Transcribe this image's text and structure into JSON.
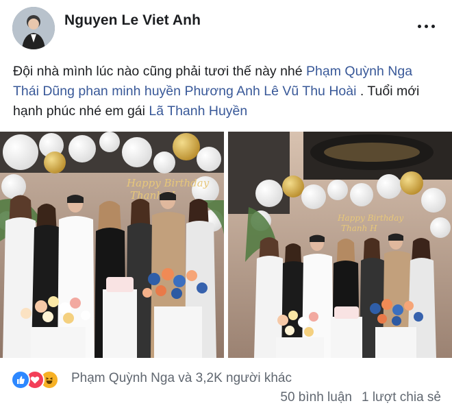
{
  "post": {
    "author": "Nguyen Le Viet Anh",
    "caption": {
      "text_1": "Đội nhà mình lúc nào cũng phải tươi thế này nhé",
      "tags_1": [
        "Phạm Quỳnh Nga",
        "Thái Dũng",
        "phan minh huyền",
        "Phương Anh",
        "Lê Vũ Thu Hoài"
      ],
      "text_2": ". Tuổi mới hạnh phúc nhé em gái",
      "tag_2": "Lã Thanh Huyền"
    },
    "photos": [
      {
        "banner_text_1": "Happy Birthday",
        "banner_text_2": "Thanh H"
      },
      {
        "banner_text_1": "Happy Birthday",
        "banner_text_2": "Thanh H"
      }
    ],
    "reactions": {
      "icons": [
        "like-icon",
        "love-icon",
        "haha-icon"
      ],
      "summary": "Phạm Quỳnh Nga và 3,2K người khác"
    },
    "comments_label": "50 bình luận",
    "shares_label": "1 lượt chia sẻ"
  },
  "colors": {
    "link": "#385898",
    "text": "#1c1e21",
    "secondary": "#606770",
    "like": "#2d88ff",
    "love": "#f33e58",
    "haha": "#f7b125"
  }
}
